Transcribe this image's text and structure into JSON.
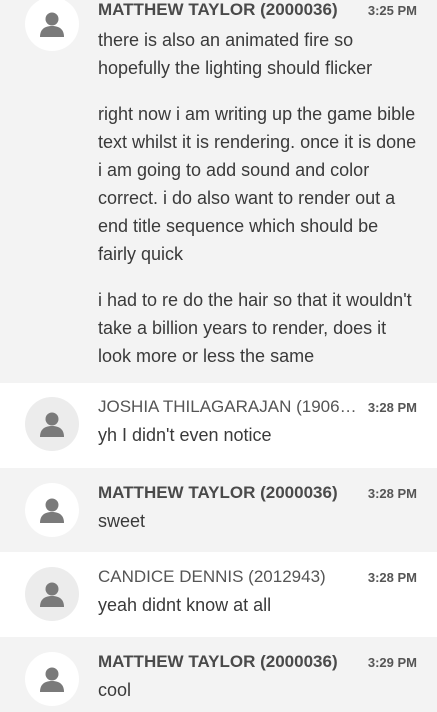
{
  "messages": [
    {
      "author": "MATTHEW TAYLOR (2000036)",
      "time": "3:25 PM",
      "paragraphs": [
        "there is also an animated fire so hopefully the lighting should flicker",
        "right now i am writing up the game bible text whilst it is rendering. once it is done i am going to add sound and color correct. i do also want to render out a end title sequence which should be fairly quick",
        "i had to re do the hair so that it wouldn't take a billion years to render, does it look more or less the same"
      ]
    },
    {
      "author": "JOSHIA THILAGARAJAN (19066...",
      "time": "3:28 PM",
      "paragraphs": [
        "yh I didn't even notice"
      ]
    },
    {
      "author": "MATTHEW TAYLOR (2000036)",
      "time": "3:28 PM",
      "paragraphs": [
        "sweet"
      ]
    },
    {
      "author": "CANDICE DENNIS (2012943)",
      "time": "3:28 PM",
      "paragraphs": [
        "yeah didnt know at all"
      ]
    },
    {
      "author": "MATTHEW TAYLOR (2000036)",
      "time": "3:29 PM",
      "paragraphs": [
        "cool"
      ]
    }
  ]
}
